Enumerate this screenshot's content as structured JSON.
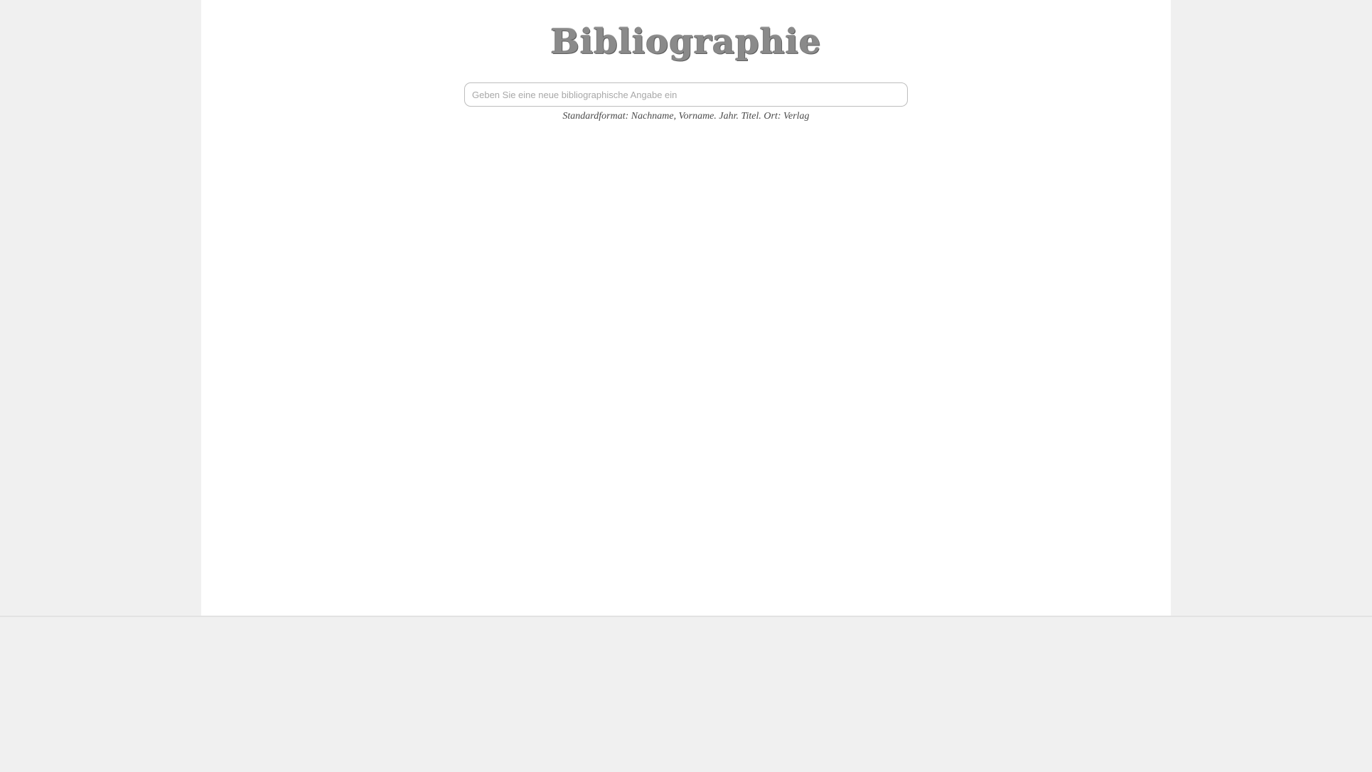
{
  "header": {
    "title": "Bibliographie"
  },
  "entry": {
    "placeholder": "Geben Sie eine neue bibliographische Angabe ein",
    "value": ""
  },
  "hint": {
    "text": "Standardformat: Nachname, Vorname. Jahr. Titel. Ort: Verlag"
  },
  "colors": {
    "background": "#f0f0f0",
    "page": "#ffffff",
    "title": "#8a8a8a"
  }
}
